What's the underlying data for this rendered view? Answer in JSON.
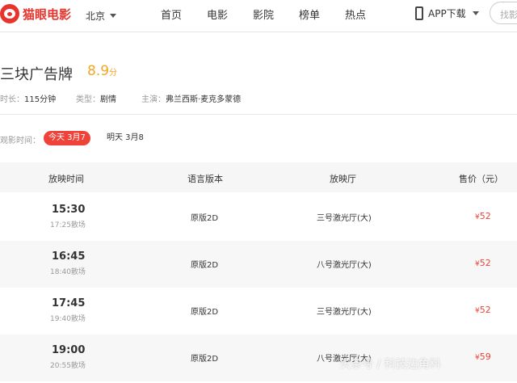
{
  "header": {
    "logo_text": "猫眼电影",
    "city": "北京",
    "nav": [
      "首页",
      "电影",
      "影院",
      "榜单",
      "热点"
    ],
    "app_label": "APP下载",
    "search_placeholder": "找影"
  },
  "movie": {
    "title": "三块广告牌",
    "score": "8.9",
    "score_unit": "分",
    "duration_label": "时长：",
    "duration": "115分钟",
    "genre_label": "类型：",
    "genre": "剧情",
    "cast_label": "主演：",
    "cast": "弗兰西斯·麦克多蒙德"
  },
  "dates": {
    "label": "观影时间：",
    "options": [
      "今天 3月7",
      "明天 3月8"
    ],
    "selected": 0
  },
  "table": {
    "headers": [
      "放映时间",
      "语言版本",
      "放映厅",
      "售价（元）"
    ],
    "rows": [
      {
        "start": "15:30",
        "end": "17:25散场",
        "lang": "原版2D",
        "hall": "三号激光厅(大)",
        "price": "52"
      },
      {
        "start": "16:45",
        "end": "18:40散场",
        "lang": "原版2D",
        "hall": "八号激光厅(大)",
        "price": "52"
      },
      {
        "start": "17:45",
        "end": "19:40散场",
        "lang": "原版2D",
        "hall": "三号激光厅(大)",
        "price": "52"
      },
      {
        "start": "19:00",
        "end": "20:55散场",
        "lang": "原版2D",
        "hall": "八号激光厅(大)",
        "price": "59"
      }
    ],
    "currency": "¥"
  },
  "watermark": "头条号 / 科技边角料"
}
